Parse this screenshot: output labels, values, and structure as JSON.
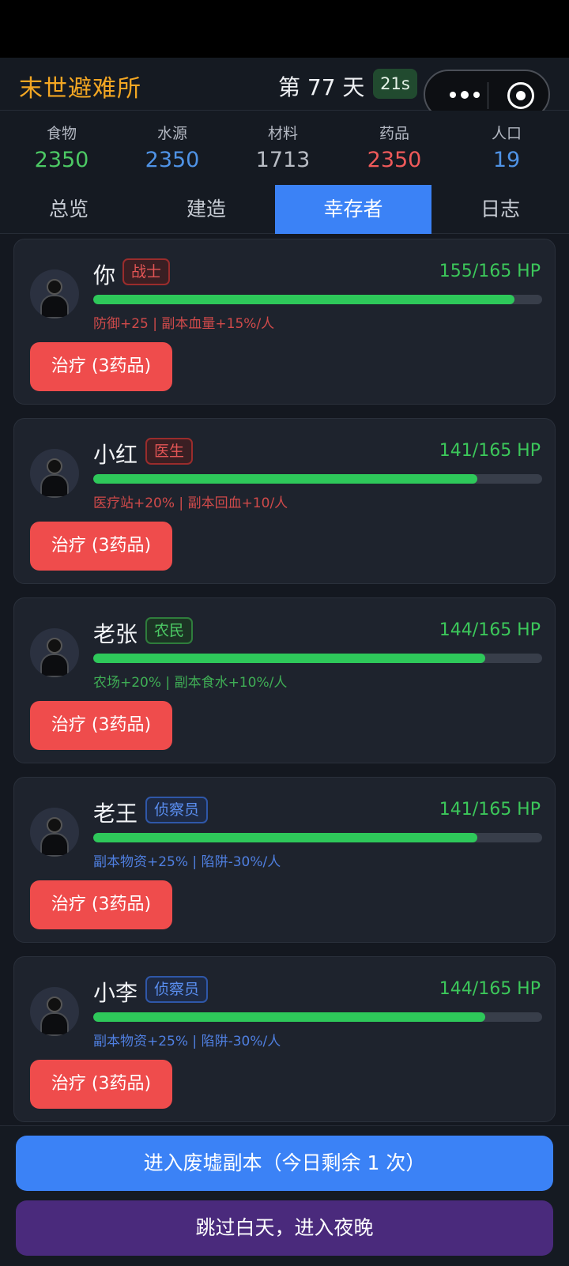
{
  "header": {
    "title": "末世避难所",
    "day": "第 77 天",
    "timer": "21s"
  },
  "resources": [
    {
      "label": "食物",
      "value": "2350",
      "color": "#4cc964"
    },
    {
      "label": "水源",
      "value": "2350",
      "color": "#4f93e6"
    },
    {
      "label": "材料",
      "value": "1713",
      "color": "#b8bcc4"
    },
    {
      "label": "药品",
      "value": "2350",
      "color": "#ef5a5a"
    },
    {
      "label": "人口",
      "value": "19",
      "color": "#4f93e6"
    }
  ],
  "tabs": [
    {
      "label": "总览",
      "active": false
    },
    {
      "label": "建造",
      "active": false
    },
    {
      "label": "幸存者",
      "active": true
    },
    {
      "label": "日志",
      "active": false
    }
  ],
  "survivors": [
    {
      "name": "你",
      "role": "战士",
      "role_color": "red",
      "hp": "155/165 HP",
      "hp_fraction": 0.939,
      "bonus": "防御+25 | 副本血量+15%/人",
      "heal_label": "治疗 (3药品)"
    },
    {
      "name": "小红",
      "role": "医生",
      "role_color": "red",
      "hp": "141/165 HP",
      "hp_fraction": 0.855,
      "bonus": "医疗站+20% | 副本回血+10/人",
      "heal_label": "治疗 (3药品)"
    },
    {
      "name": "老张",
      "role": "农民",
      "role_color": "green",
      "hp": "144/165 HP",
      "hp_fraction": 0.873,
      "bonus": "农场+20% | 副本食水+10%/人",
      "heal_label": "治疗 (3药品)"
    },
    {
      "name": "老王",
      "role": "侦察员",
      "role_color": "blue",
      "hp": "141/165 HP",
      "hp_fraction": 0.855,
      "bonus": "副本物资+25% | 陷阱-30%/人",
      "heal_label": "治疗 (3药品)"
    },
    {
      "name": "小李",
      "role": "侦察员",
      "role_color": "blue",
      "hp": "144/165 HP",
      "hp_fraction": 0.873,
      "bonus": "副本物资+25% | 陷阱-30%/人",
      "heal_label": "治疗 (3药品)"
    }
  ],
  "footer": {
    "enter_label": "进入废墟副本（今日剩余 1 次）",
    "skip_label": "跳过白天，进入夜晚"
  }
}
